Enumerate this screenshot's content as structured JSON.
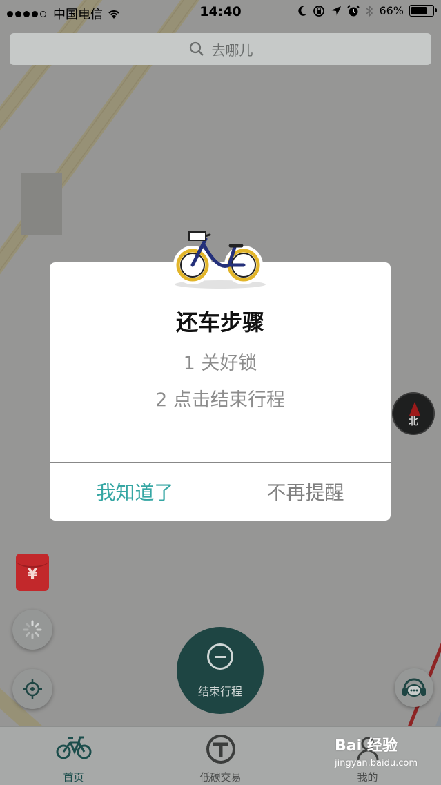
{
  "status_bar": {
    "carrier": "中国电信",
    "time": "14:40",
    "battery": "66%",
    "battery_level": 0.66,
    "icons": [
      "signal-dots-icon",
      "wifi-icon",
      "moon-icon",
      "orientation-lock-icon",
      "location-arrow-icon",
      "alarm-icon",
      "bluetooth-icon",
      "battery-icon"
    ]
  },
  "search": {
    "placeholder": "去哪儿",
    "icon": "search-icon"
  },
  "map": {
    "compass_label": "北",
    "red_packet_symbol": "¥"
  },
  "end_trip": {
    "label": "结束行程",
    "icon": "minus-circle-icon"
  },
  "dialog": {
    "title": "还车步骤",
    "steps": [
      "1 关好锁",
      "2 点击结束行程"
    ],
    "confirm_label": "我知道了",
    "dismiss_label": "不再提醒",
    "image": "bicycle-icon"
  },
  "tabbar": {
    "tabs": [
      {
        "label": "首页",
        "icon": "bike-icon",
        "active": true
      },
      {
        "label": "低碳交易",
        "icon": "trade-t-icon",
        "active": false
      },
      {
        "label": "我的",
        "icon": "user-icon",
        "active": false
      }
    ]
  },
  "watermark": {
    "brand": "Bai 经验",
    "url": "jingyan.baidu.com"
  },
  "colors": {
    "accent": "#35a6a3",
    "end_trip_bg": "#1e4543",
    "red_packet": "#c2282b"
  }
}
